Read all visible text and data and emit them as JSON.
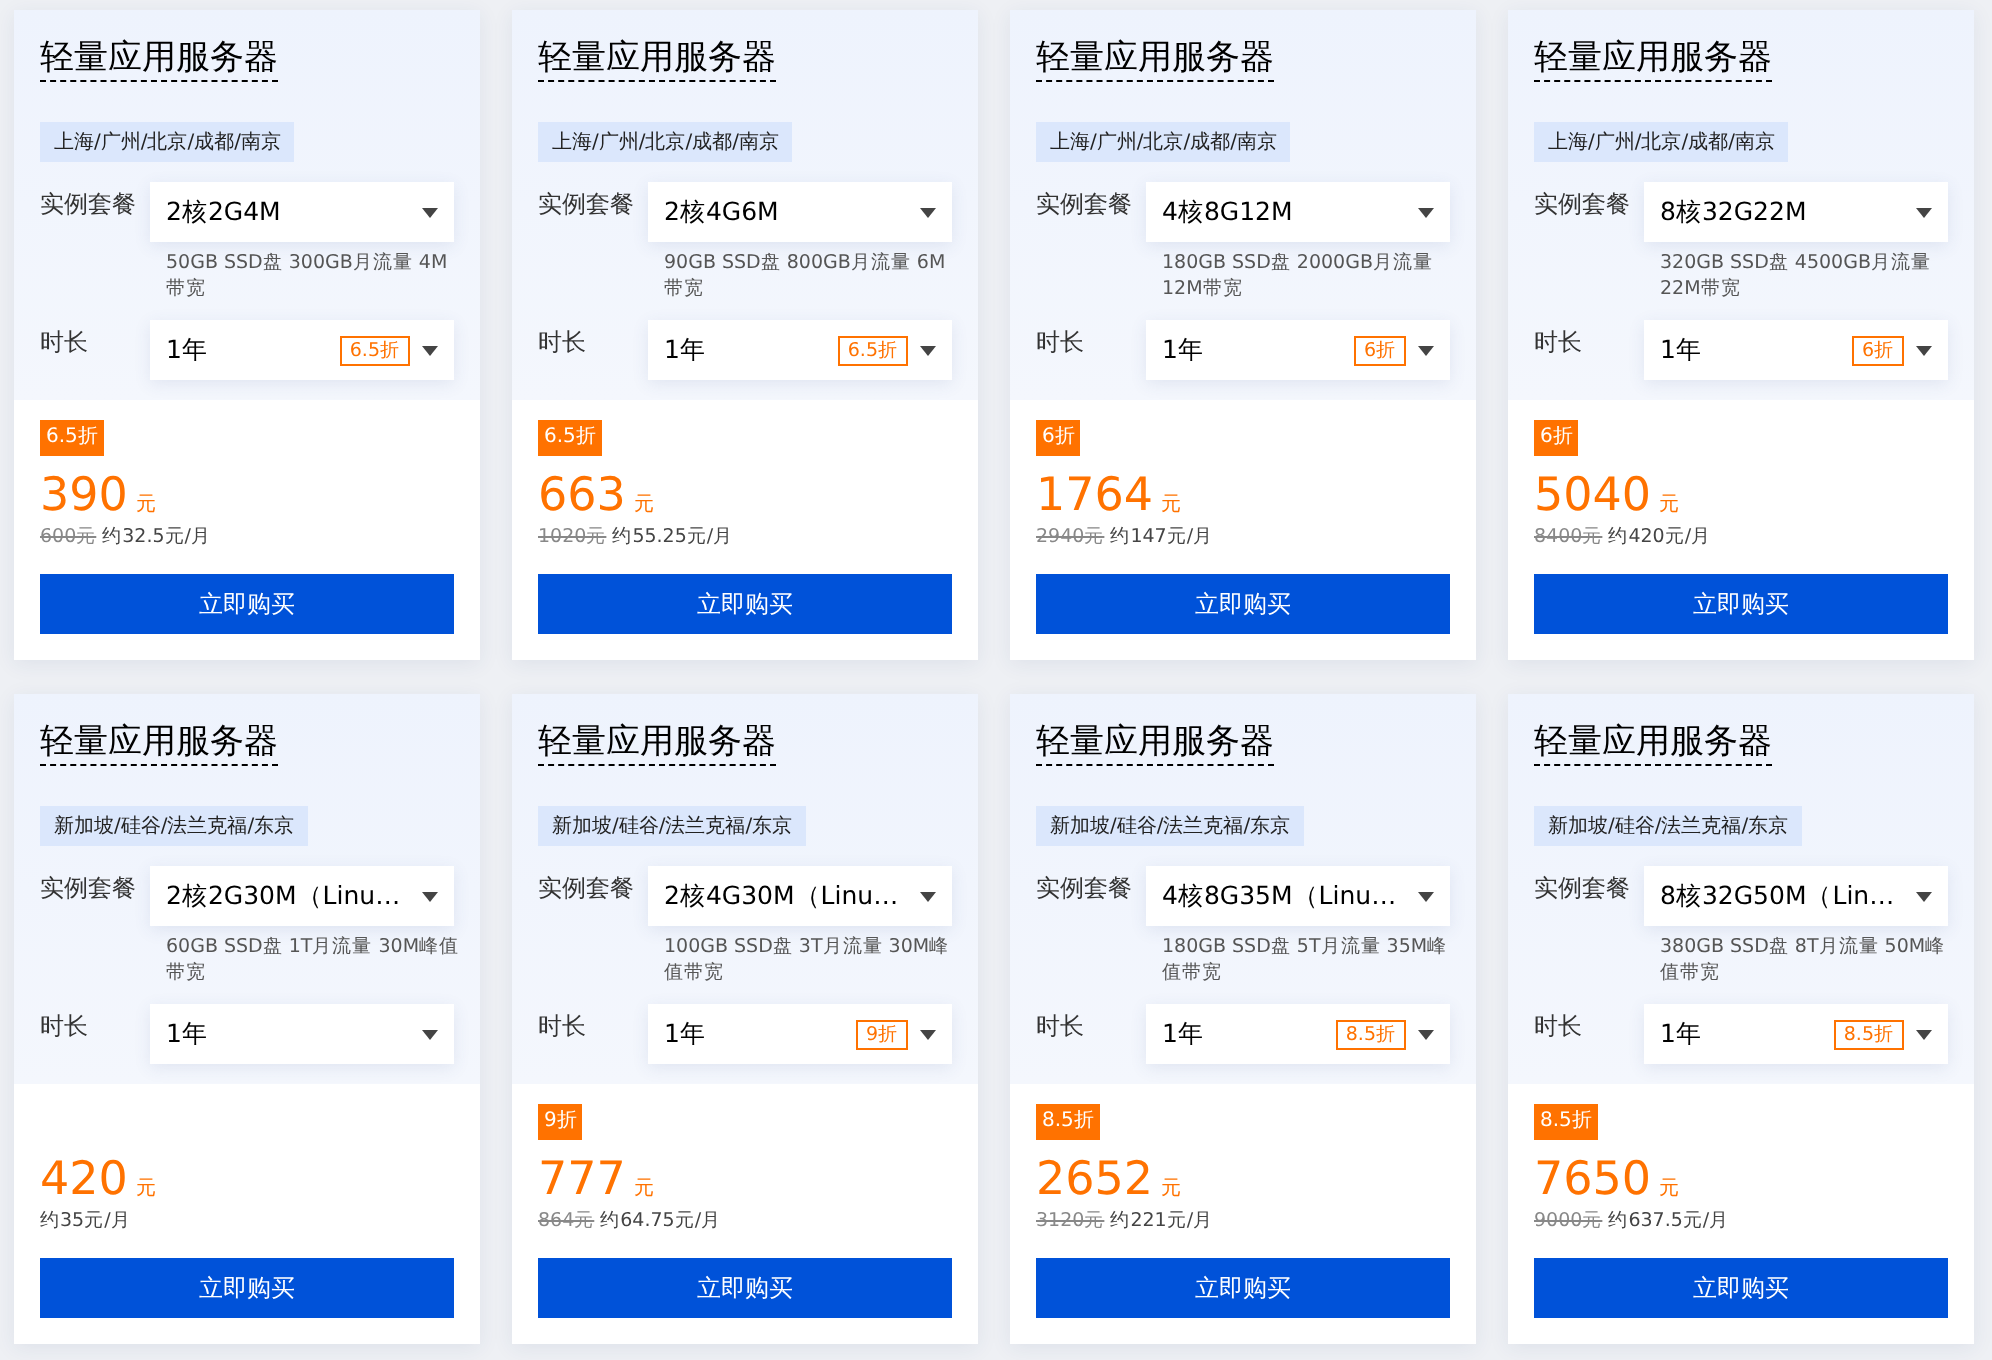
{
  "cards": [
    {
      "title": "轻量应用服务器",
      "regions": "上海/广州/北京/成都/南京",
      "plan_label": "实例套餐",
      "plan": "2核2G4M",
      "spec": "50GB SSD盘 300GB月流量 4M带宽",
      "duration_label": "时长",
      "duration": "1年",
      "duration_discount": "6.5折",
      "discount": "6.5折",
      "price": "390",
      "unit": "元",
      "original_price": "600元",
      "monthly": "约32.5元/月",
      "button": "立即购买"
    },
    {
      "title": "轻量应用服务器",
      "regions": "上海/广州/北京/成都/南京",
      "plan_label": "实例套餐",
      "plan": "2核4G6M",
      "spec": "90GB SSD盘 800GB月流量 6M带宽",
      "duration_label": "时长",
      "duration": "1年",
      "duration_discount": "6.5折",
      "discount": "6.5折",
      "price": "663",
      "unit": "元",
      "original_price": "1020元",
      "monthly": "约55.25元/月",
      "button": "立即购买"
    },
    {
      "title": "轻量应用服务器",
      "regions": "上海/广州/北京/成都/南京",
      "plan_label": "实例套餐",
      "plan": "4核8G12M",
      "spec": "180GB SSD盘 2000GB月流量 12M带宽",
      "duration_label": "时长",
      "duration": "1年",
      "duration_discount": "6折",
      "discount": "6折",
      "price": "1764",
      "unit": "元",
      "original_price": "2940元",
      "monthly": "约147元/月",
      "button": "立即购买"
    },
    {
      "title": "轻量应用服务器",
      "regions": "上海/广州/北京/成都/南京",
      "plan_label": "实例套餐",
      "plan": "8核32G22M",
      "spec": "320GB SSD盘 4500GB月流量 22M带宽",
      "duration_label": "时长",
      "duration": "1年",
      "duration_discount": "6折",
      "discount": "6折",
      "price": "5040",
      "unit": "元",
      "original_price": "8400元",
      "monthly": "约420元/月",
      "button": "立即购买"
    },
    {
      "title": "轻量应用服务器",
      "regions": "新加坡/硅谷/法兰克福/东京",
      "plan_label": "实例套餐",
      "plan": "2核2G30M（Linu…",
      "spec": "60GB SSD盘 1T月流量 30M峰值带宽",
      "duration_label": "时长",
      "duration": "1年",
      "price": "420",
      "unit": "元",
      "monthly": "约35元/月",
      "button": "立即购买"
    },
    {
      "title": "轻量应用服务器",
      "regions": "新加坡/硅谷/法兰克福/东京",
      "plan_label": "实例套餐",
      "plan": "2核4G30M（Linu…",
      "spec": "100GB SSD盘 3T月流量 30M峰值带宽",
      "duration_label": "时长",
      "duration": "1年",
      "duration_discount": "9折",
      "discount": "9折",
      "price": "777",
      "unit": "元",
      "original_price": "864元",
      "monthly": "约64.75元/月",
      "button": "立即购买"
    },
    {
      "title": "轻量应用服务器",
      "regions": "新加坡/硅谷/法兰克福/东京",
      "plan_label": "实例套餐",
      "plan": "4核8G35M（Linu…",
      "spec": "180GB SSD盘 5T月流量 35M峰值带宽",
      "duration_label": "时长",
      "duration": "1年",
      "duration_discount": "8.5折",
      "discount": "8.5折",
      "price": "2652",
      "unit": "元",
      "original_price": "3120元",
      "monthly": "约221元/月",
      "button": "立即购买"
    },
    {
      "title": "轻量应用服务器",
      "regions": "新加坡/硅谷/法兰克福/东京",
      "plan_label": "实例套餐",
      "plan": "8核32G50M（Lin…",
      "spec": "380GB SSD盘 8T月流量 50M峰值带宽",
      "duration_label": "时长",
      "duration": "1年",
      "duration_discount": "8.5折",
      "discount": "8.5折",
      "price": "7650",
      "unit": "元",
      "original_price": "9000元",
      "monthly": "约637.5元/月",
      "button": "立即购买"
    }
  ]
}
